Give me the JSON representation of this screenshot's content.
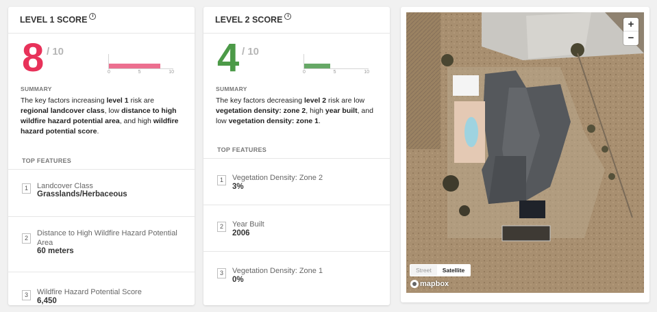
{
  "colors": {
    "level1": "#e8325a",
    "level1_bar": "#ec6f8f",
    "level2": "#4c9a48",
    "level2_bar": "#66a866"
  },
  "level1": {
    "title": "LEVEL 1 SCORE",
    "info_icon": "i",
    "score": "8",
    "out_of": "/ 10",
    "bar_value": 8,
    "bar_ticks": [
      "0",
      "5",
      "10"
    ],
    "summary_label": "SUMMARY",
    "summary": [
      {
        "t": "The key factors increasing ",
        "b": false
      },
      {
        "t": "level 1",
        "b": true
      },
      {
        "t": " risk are ",
        "b": false
      },
      {
        "t": "regional landcover class",
        "b": true
      },
      {
        "t": ", low ",
        "b": false
      },
      {
        "t": "distance to high wildfire hazard potential area",
        "b": true
      },
      {
        "t": ", and high ",
        "b": false
      },
      {
        "t": "wildfire hazard potential score",
        "b": true
      },
      {
        "t": ".",
        "b": false
      }
    ],
    "features_label": "TOP FEATURES",
    "features": [
      {
        "num": "1",
        "name": "Landcover Class",
        "value": "Grasslands/Herbaceous"
      },
      {
        "num": "2",
        "name": "Distance to High Wildfire Hazard Potential Area",
        "value": "60 meters"
      },
      {
        "num": "3",
        "name": "Wildfire Hazard Potential Score",
        "value": "6,450"
      }
    ]
  },
  "level2": {
    "title": "LEVEL 2 SCORE",
    "info_icon": "i",
    "score": "4",
    "out_of": "/ 10",
    "bar_value": 4,
    "bar_ticks": [
      "0",
      "5",
      "10"
    ],
    "summary_label": "SUMMARY",
    "summary": [
      {
        "t": "The key factors decreasing ",
        "b": false
      },
      {
        "t": "level 2",
        "b": true
      },
      {
        "t": " risk are low ",
        "b": false
      },
      {
        "t": "vegetation density: zone 2",
        "b": true
      },
      {
        "t": ", high ",
        "b": false
      },
      {
        "t": "year built",
        "b": true
      },
      {
        "t": ", and low ",
        "b": false
      },
      {
        "t": "vegetation density: zone 1",
        "b": true
      },
      {
        "t": ".",
        "b": false
      }
    ],
    "features_label": "TOP FEATURES",
    "features": [
      {
        "num": "1",
        "name": "Vegetation Density: Zone 2",
        "value": "3%"
      },
      {
        "num": "2",
        "name": "Year Built",
        "value": "2006"
      },
      {
        "num": "3",
        "name": "Vegetation Density: Zone 1",
        "value": "0%"
      }
    ]
  },
  "map": {
    "zoom_in": "+",
    "zoom_out": "−",
    "style_options": [
      "Street",
      "Satellite"
    ],
    "active_style": "Satellite",
    "attribution": "mapbox"
  }
}
